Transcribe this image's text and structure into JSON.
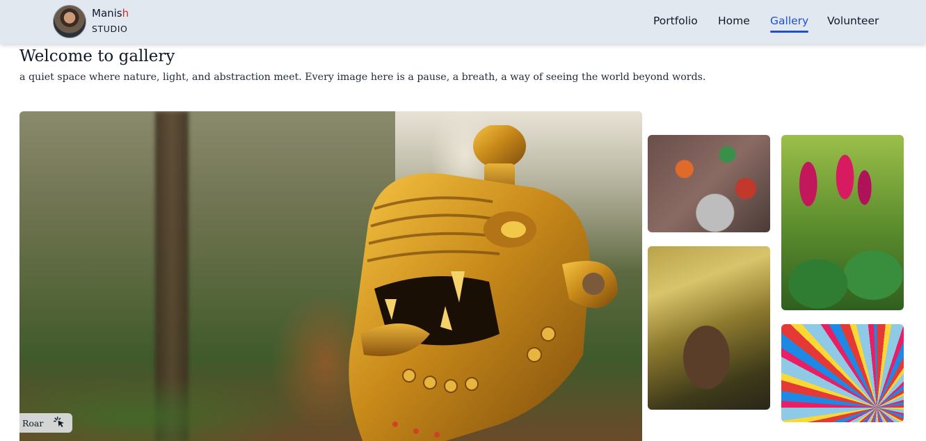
{
  "header": {
    "brand_name_main": "Manis",
    "brand_name_accent": "h",
    "brand_sub": "STUDIO",
    "nav": [
      {
        "label": "Portfolio",
        "active": false
      },
      {
        "label": "Home",
        "active": false
      },
      {
        "label": "Gallery",
        "active": true
      },
      {
        "label": "Volunteer",
        "active": false
      }
    ]
  },
  "intro": {
    "title": "Welcome to gallery",
    "subtitle": "a quiet space where nature, light, and abstraction meet. Every image here is a pause, a breath, a way of seeing the world beyond words."
  },
  "gallery": {
    "featured": {
      "caption": "Roar",
      "icon": "cursor-click-icon"
    },
    "thumbnails": [
      {
        "name": "market-scene-photo"
      },
      {
        "name": "pine-cone-photo"
      },
      {
        "name": "celosia-flowers-photo"
      },
      {
        "name": "colorful-canopy-photo"
      }
    ]
  },
  "colors": {
    "header_bg": "#e2e8f0",
    "accent": "#dc2626",
    "nav_active": "#1d4ed8",
    "text": "#111827"
  }
}
